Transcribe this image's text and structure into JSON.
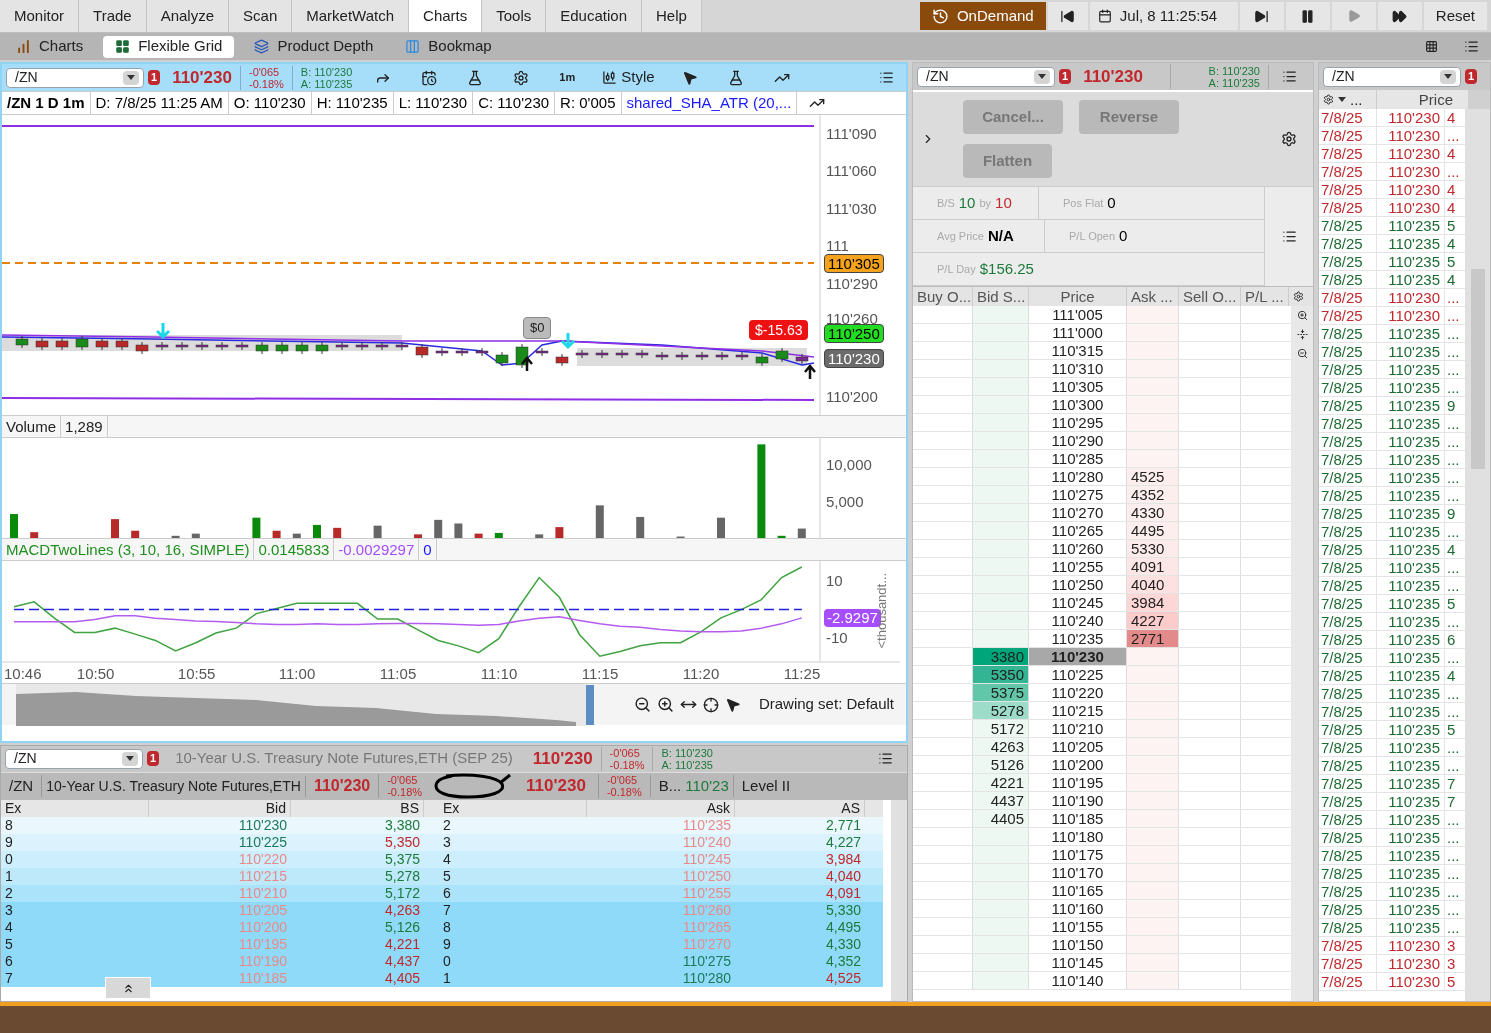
{
  "menu_tabs": [
    {
      "label": "Monitor",
      "selected": false
    },
    {
      "label": "Trade",
      "selected": false
    },
    {
      "label": "Analyze",
      "selected": false
    },
    {
      "label": "Scan",
      "selected": false
    },
    {
      "label": "MarketWatch",
      "selected": false
    },
    {
      "label": "Charts",
      "selected": true
    },
    {
      "label": "Tools",
      "selected": false
    },
    {
      "label": "Education",
      "selected": false
    },
    {
      "label": "Help",
      "selected": false
    }
  ],
  "playback": {
    "ondemand": "OnDemand",
    "datetime": "Jul, 8 11:25:54",
    "reset": "Reset"
  },
  "sub_tabs": [
    {
      "label": "Charts",
      "kind": "bars",
      "selected": false
    },
    {
      "label": "Flexible Grid",
      "kind": "grid",
      "selected": true
    },
    {
      "label": "Product Depth",
      "kind": "depth",
      "selected": false
    },
    {
      "label": "Bookmap",
      "kind": "bookmap",
      "selected": false
    }
  ],
  "chart": {
    "symbol": "/ZN",
    "badge": "1",
    "last": "110'230",
    "change": "-0'065",
    "change_pct": "-0.18%",
    "bid": "B: 110'230",
    "ask": "A: 110'235",
    "interval": "1m",
    "style": "Style",
    "info": [
      {
        "text": "/ZN 1 D 1m",
        "kind": "title"
      },
      {
        "text": "D: 7/8/25 11:25 AM",
        "kind": "plain"
      },
      {
        "text": "O: 110'230",
        "kind": "plain"
      },
      {
        "text": "H: 110'235",
        "kind": "plain"
      },
      {
        "text": "L: 110'230",
        "kind": "plain"
      },
      {
        "text": "C: 110'230",
        "kind": "plain"
      },
      {
        "text": "R: 0'005",
        "kind": "plain"
      },
      {
        "text": "shared_SHA_ATR (20,...",
        "kind": "study"
      }
    ],
    "price_axis": [
      "111'090",
      "111'060",
      "111'030",
      "111",
      "110'290",
      "110'260",
      "110'200"
    ],
    "markers": [
      {
        "text": "110'305",
        "color": "#f5a31c"
      },
      {
        "text": "110'250",
        "color": "#22dd22"
      },
      {
        "text": "110'230",
        "color": "#6b6b6b"
      }
    ],
    "pl_bubble": "$-15.63",
    "order_bubble": "$0",
    "volume": {
      "label": "Volume",
      "value": "1,289",
      "axis_labels": [
        "10,000",
        "5,000"
      ]
    },
    "macd": {
      "label": "MACDTwoLines (3, 10, 16, SIMPLE)",
      "values": [
        {
          "text": "0.0145833",
          "color": "#1f8f1f"
        },
        {
          "text": "-0.0029297",
          "color": "#a64dff"
        },
        {
          "text": "0",
          "color": "#1a1aff"
        }
      ],
      "marker": "-2.9297",
      "axis_note": "<thousandt...",
      "chart_data": {
        "type": "line",
        "categories": [
          "10:46",
          null,
          null,
          null,
          "10:50",
          null,
          null,
          null,
          null,
          "10:55",
          null,
          null,
          null,
          null,
          "11:00",
          null,
          null,
          null,
          null,
          "11:05",
          null,
          null,
          null,
          null,
          "11:10",
          null,
          null,
          null,
          null,
          "11:15",
          null,
          null,
          null,
          null,
          "11:20",
          null,
          null,
          null,
          null,
          "11:25"
        ],
        "series": [
          {
            "color": "#3fa33f",
            "values": [
              1.0,
              2.7,
              -3,
              -8,
              -8,
              -6.5,
              -8.6,
              -10.8,
              -14.5,
              -11.6,
              -8.2,
              -6.5,
              -1.4,
              0.4,
              2.2,
              2.2,
              2.2,
              2.2,
              -3.3,
              -3.3,
              -7.1,
              -10.8,
              -12.7,
              -15.1,
              -10.2,
              1.0,
              11.2,
              4.3,
              -8.8,
              -16.3,
              -14.7,
              -12.7,
              -11.6,
              -11.6,
              -7.8,
              -2.9,
              0,
              3.5,
              11.2,
              14.9
            ]
          },
          {
            "color": "#b45cf0",
            "values": [
              -4.3,
              -4.3,
              -4.3,
              -4.3,
              -3.5,
              -2.2,
              -2.2,
              -3,
              -3.5,
              -4,
              -4.2,
              -4.5,
              -5,
              -5.2,
              -5.2,
              -5,
              -5.2,
              -5.2,
              -5,
              -4.9,
              -4.9,
              -5,
              -5.2,
              -5.5,
              -5.2,
              -4,
              -3,
              -2.5,
              -3.8,
              -5,
              -5.8,
              -6.2,
              -7,
              -7.5,
              -7.8,
              -7.8,
              -7.5,
              -6.5,
              -5,
              -2.9
            ]
          },
          {
            "color": "#2222dd",
            "line_style": "dashed",
            "values": [
              0,
              0,
              0,
              0,
              0,
              0,
              0,
              0,
              0,
              0,
              0,
              0,
              0,
              0,
              0,
              0,
              0,
              0,
              0,
              0,
              0,
              0,
              0,
              0,
              0,
              0,
              0,
              0,
              0,
              0,
              0,
              0,
              0,
              0,
              0,
              0,
              0,
              0,
              0,
              0
            ]
          }
        ],
        "ylim": [
          -18,
          17
        ],
        "yticks": [
          10,
          -10
        ]
      }
    },
    "drawing_set": "Drawing set: Default"
  },
  "level2": {
    "symbol": "/ZN",
    "badge": "1",
    "description": "10-Year U.S. Treasury Note Futures,ETH (SEP 25)",
    "last": "110'230",
    "change": "-0'065",
    "change_pct": "-0.18%",
    "bid": "B: 110'230",
    "ask": "A: 110'235",
    "row2": {
      "symbol": "/ZN",
      "description": "10-Year U.S. Treasury Note Futures,ETH",
      "last": "110'230",
      "change": "-0'065",
      "change_pct": "-0.18%",
      "last2": "110'230",
      "change2": "-0'065",
      "change_pct2": "-0.18%",
      "bid_label": "B...",
      "bid": "110'23",
      "mode": "Level II"
    },
    "columns": [
      "Ex",
      "Bid",
      "BS",
      "Ex",
      "Ask",
      "AS"
    ],
    "rows": [
      {
        "color": "#eaf7fd",
        "bid_ex": "8",
        "bid": "110'230",
        "bid_up": true,
        "bs": "3,380",
        "bs_up": true,
        "ask_ex": "2",
        "ask": "110'235",
        "ask_up": false,
        "as": "2,771",
        "as_up": true
      },
      {
        "color": "#dcf3fd",
        "bid_ex": "9",
        "bid": "110'225",
        "bid_up": true,
        "bs": "5,350",
        "bs_up": false,
        "ask_ex": "3",
        "ask": "110'240",
        "ask_up": false,
        "as": "4,227",
        "as_up": true
      },
      {
        "color": "#cdeefc",
        "bid_ex": "0",
        "bid": "110'220",
        "bid_up": false,
        "bs": "5,375",
        "bs_up": true,
        "ask_ex": "4",
        "ask": "110'245",
        "ask_up": false,
        "as": "3,984",
        "as_up": false
      },
      {
        "color": "#bde9fb",
        "bid_ex": "1",
        "bid": "110'215",
        "bid_up": false,
        "bs": "5,278",
        "bs_up": true,
        "ask_ex": "5",
        "ask": "110'250",
        "ask_up": false,
        "as": "4,040",
        "as_up": false
      },
      {
        "color": "#abe3fb",
        "bid_ex": "2",
        "bid": "110'210",
        "bid_up": false,
        "bs": "5,172",
        "bs_up": true,
        "ask_ex": "6",
        "ask": "110'255",
        "ask_up": false,
        "as": "4,091",
        "as_up": false
      },
      {
        "color": "#8fdaf9",
        "bid_ex": "3",
        "bid": "110'205",
        "bid_up": false,
        "bs": "4,263",
        "bs_up": false,
        "ask_ex": "7",
        "ask": "110'260",
        "ask_up": false,
        "as": "5,330",
        "as_up": true
      },
      {
        "color": "#8fdaf9",
        "bid_ex": "4",
        "bid": "110'200",
        "bid_up": false,
        "bs": "5,126",
        "bs_up": true,
        "ask_ex": "8",
        "ask": "110'265",
        "ask_up": false,
        "as": "4,495",
        "as_up": true
      },
      {
        "color": "#8fdaf9",
        "bid_ex": "5",
        "bid": "110'195",
        "bid_up": false,
        "bs": "4,221",
        "bs_up": false,
        "ask_ex": "9",
        "ask": "110'270",
        "ask_up": false,
        "as": "4,330",
        "as_up": true
      },
      {
        "color": "#8fdaf9",
        "bid_ex": "6",
        "bid": "110'190",
        "bid_up": false,
        "bs": "4,437",
        "bs_up": false,
        "ask_ex": "0",
        "ask": "110'275",
        "ask_up": true,
        "as": "4,352",
        "as_up": true
      },
      {
        "color": "#8fdaf9",
        "bid_ex": "7",
        "bid": "110'185",
        "bid_up": false,
        "bs": "4,405",
        "bs_up": false,
        "ask_ex": "1",
        "ask": "110'280",
        "ask_up": true,
        "as": "4,525",
        "as_up": false
      }
    ]
  },
  "active_trader": {
    "symbol": "/ZN",
    "badge": "1",
    "last": "110'230",
    "bid": "B: 110'230",
    "ask": "A: 110'235",
    "buttons": [
      "Cancel...",
      "Reverse",
      "Flatten"
    ],
    "bs_label": "B/S",
    "bs_buy": "10",
    "bs_by": "by",
    "bs_sell": "10",
    "stats": [
      {
        "label": "Pos Flat",
        "value": "0",
        "kind": "plain"
      },
      {
        "label": "Avg Price",
        "value": "N/A",
        "kind": "bold"
      },
      {
        "label": "P/L Open",
        "value": "0",
        "kind": "plain"
      },
      {
        "label": "P/L Day",
        "value": "$156.25",
        "kind": "gain"
      }
    ],
    "columns": [
      "Buy O...",
      "Bid S...",
      "Price",
      "Ask ...",
      "Sell O...",
      "P/L ..."
    ],
    "rows": [
      {
        "price": "111'005",
        "selected": false
      },
      {
        "price": "111'000",
        "selected": false
      },
      {
        "price": "110'315",
        "selected": false
      },
      {
        "price": "110'310",
        "selected": false
      },
      {
        "price": "110'305",
        "selected": false
      },
      {
        "price": "110'300",
        "selected": false
      },
      {
        "price": "110'295",
        "selected": false
      },
      {
        "price": "110'290",
        "selected": false
      },
      {
        "price": "110'285",
        "selected": false
      },
      {
        "price": "110'280",
        "selected": false,
        "ask": {
          "size": "4525",
          "color": "#fdeeee"
        }
      },
      {
        "price": "110'275",
        "selected": false,
        "ask": {
          "size": "4352",
          "color": "#fdeeee"
        }
      },
      {
        "price": "110'270",
        "selected": false,
        "ask": {
          "size": "4330",
          "color": "#fdeeee"
        }
      },
      {
        "price": "110'265",
        "selected": false,
        "ask": {
          "size": "4495",
          "color": "#fdeeee"
        }
      },
      {
        "price": "110'260",
        "selected": false,
        "ask": {
          "size": "5330",
          "color": "#fdeaea"
        }
      },
      {
        "price": "110'255",
        "selected": false,
        "ask": {
          "size": "4091",
          "color": "#fde6e6"
        }
      },
      {
        "price": "110'250",
        "selected": false,
        "ask": {
          "size": "4040",
          "color": "#fde0e0"
        }
      },
      {
        "price": "110'245",
        "selected": false,
        "ask": {
          "size": "3984",
          "color": "#fdd6d6"
        }
      },
      {
        "price": "110'240",
        "selected": false,
        "ask": {
          "size": "4227",
          "color": "#fccbcb"
        }
      },
      {
        "price": "110'235",
        "selected": false,
        "ask": {
          "size": "2771",
          "color": "#e38a8a"
        }
      },
      {
        "price": "110'230",
        "selected": true,
        "bid": {
          "size": "3380",
          "color": "#00a67a"
        }
      },
      {
        "price": "110'225",
        "selected": false,
        "bid": {
          "size": "5350",
          "color": "#33b493"
        }
      },
      {
        "price": "110'220",
        "selected": false,
        "bid": {
          "size": "5375",
          "color": "#62c7a9"
        }
      },
      {
        "price": "110'215",
        "selected": false,
        "bid": {
          "size": "5278",
          "color": "#9ddcc8"
        }
      },
      {
        "price": "110'210",
        "selected": false,
        "bid": {
          "size": "5172",
          "color": "#eef8f3"
        }
      },
      {
        "price": "110'205",
        "selected": false,
        "bid": {
          "size": "4263",
          "color": "#eef8f3"
        }
      },
      {
        "price": "110'200",
        "selected": false,
        "bid": {
          "size": "5126",
          "color": "#eef8f3"
        }
      },
      {
        "price": "110'195",
        "selected": false,
        "bid": {
          "size": "4221",
          "color": "#eef8f3"
        }
      },
      {
        "price": "110'190",
        "selected": false,
        "bid": {
          "size": "4437",
          "color": "#eef8f3"
        }
      },
      {
        "price": "110'185",
        "selected": false,
        "bid": {
          "size": "4405",
          "color": "#eef8f3"
        }
      },
      {
        "price": "110'180",
        "selected": false
      },
      {
        "price": "110'175",
        "selected": false
      },
      {
        "price": "110'170",
        "selected": false
      },
      {
        "price": "110'165",
        "selected": false
      },
      {
        "price": "110'160",
        "selected": false
      },
      {
        "price": "110'155",
        "selected": false
      },
      {
        "price": "110'150",
        "selected": false
      },
      {
        "price": "110'145",
        "selected": false
      },
      {
        "price": "110'140",
        "selected": false
      }
    ]
  },
  "time_sales": {
    "symbol": "/ZN",
    "badge": "1",
    "columns": [
      "...",
      "Price"
    ],
    "rows": [
      {
        "date": "7/8/25",
        "price": "110'230",
        "size": "4",
        "up": false
      },
      {
        "date": "7/8/25",
        "price": "110'230",
        "size": "...",
        "up": false
      },
      {
        "date": "7/8/25",
        "price": "110'230",
        "size": "4",
        "up": false
      },
      {
        "date": "7/8/25",
        "price": "110'230",
        "size": "...",
        "up": false
      },
      {
        "date": "7/8/25",
        "price": "110'230",
        "size": "4",
        "up": false
      },
      {
        "date": "7/8/25",
        "price": "110'230",
        "size": "4",
        "up": false
      },
      {
        "date": "7/8/25",
        "price": "110'235",
        "size": "5",
        "up": true
      },
      {
        "date": "7/8/25",
        "price": "110'235",
        "size": "4",
        "up": true
      },
      {
        "date": "7/8/25",
        "price": "110'235",
        "size": "5",
        "up": true
      },
      {
        "date": "7/8/25",
        "price": "110'235",
        "size": "4",
        "up": true
      },
      {
        "date": "7/8/25",
        "price": "110'230",
        "size": "...",
        "up": false
      },
      {
        "date": "7/8/25",
        "price": "110'230",
        "size": "...",
        "up": false
      },
      {
        "date": "7/8/25",
        "price": "110'235",
        "size": "...",
        "up": true
      },
      {
        "date": "7/8/25",
        "price": "110'235",
        "size": "...",
        "up": true
      },
      {
        "date": "7/8/25",
        "price": "110'235",
        "size": "...",
        "up": true
      },
      {
        "date": "7/8/25",
        "price": "110'235",
        "size": "...",
        "up": true
      },
      {
        "date": "7/8/25",
        "price": "110'235",
        "size": "9",
        "up": true
      },
      {
        "date": "7/8/25",
        "price": "110'235",
        "size": "...",
        "up": true
      },
      {
        "date": "7/8/25",
        "price": "110'235",
        "size": "...",
        "up": true
      },
      {
        "date": "7/8/25",
        "price": "110'235",
        "size": "...",
        "up": true
      },
      {
        "date": "7/8/25",
        "price": "110'235",
        "size": "...",
        "up": true
      },
      {
        "date": "7/8/25",
        "price": "110'235",
        "size": "...",
        "up": true
      },
      {
        "date": "7/8/25",
        "price": "110'235",
        "size": "9",
        "up": true
      },
      {
        "date": "7/8/25",
        "price": "110'235",
        "size": "...",
        "up": true
      },
      {
        "date": "7/8/25",
        "price": "110'235",
        "size": "4",
        "up": true
      },
      {
        "date": "7/8/25",
        "price": "110'235",
        "size": "...",
        "up": true
      },
      {
        "date": "7/8/25",
        "price": "110'235",
        "size": "...",
        "up": true
      },
      {
        "date": "7/8/25",
        "price": "110'235",
        "size": "5",
        "up": true
      },
      {
        "date": "7/8/25",
        "price": "110'235",
        "size": "...",
        "up": true
      },
      {
        "date": "7/8/25",
        "price": "110'235",
        "size": "6",
        "up": true
      },
      {
        "date": "7/8/25",
        "price": "110'235",
        "size": "...",
        "up": true
      },
      {
        "date": "7/8/25",
        "price": "110'235",
        "size": "4",
        "up": true
      },
      {
        "date": "7/8/25",
        "price": "110'235",
        "size": "...",
        "up": true
      },
      {
        "date": "7/8/25",
        "price": "110'235",
        "size": "...",
        "up": true
      },
      {
        "date": "7/8/25",
        "price": "110'235",
        "size": "5",
        "up": true
      },
      {
        "date": "7/8/25",
        "price": "110'235",
        "size": "...",
        "up": true
      },
      {
        "date": "7/8/25",
        "price": "110'235",
        "size": "...",
        "up": true
      },
      {
        "date": "7/8/25",
        "price": "110'235",
        "size": "7",
        "up": true
      },
      {
        "date": "7/8/25",
        "price": "110'235",
        "size": "7",
        "up": true
      },
      {
        "date": "7/8/25",
        "price": "110'235",
        "size": "...",
        "up": true
      },
      {
        "date": "7/8/25",
        "price": "110'235",
        "size": "...",
        "up": true
      },
      {
        "date": "7/8/25",
        "price": "110'235",
        "size": "...",
        "up": true
      },
      {
        "date": "7/8/25",
        "price": "110'235",
        "size": "...",
        "up": true
      },
      {
        "date": "7/8/25",
        "price": "110'235",
        "size": "...",
        "up": true
      },
      {
        "date": "7/8/25",
        "price": "110'235",
        "size": "...",
        "up": true
      },
      {
        "date": "7/8/25",
        "price": "110'235",
        "size": "...",
        "up": true
      },
      {
        "date": "7/8/25",
        "price": "110'230",
        "size": "3",
        "up": false
      },
      {
        "date": "7/8/25",
        "price": "110'230",
        "size": "3",
        "up": false
      },
      {
        "date": "7/8/25",
        "price": "110'230",
        "size": "5",
        "up": false
      }
    ]
  }
}
